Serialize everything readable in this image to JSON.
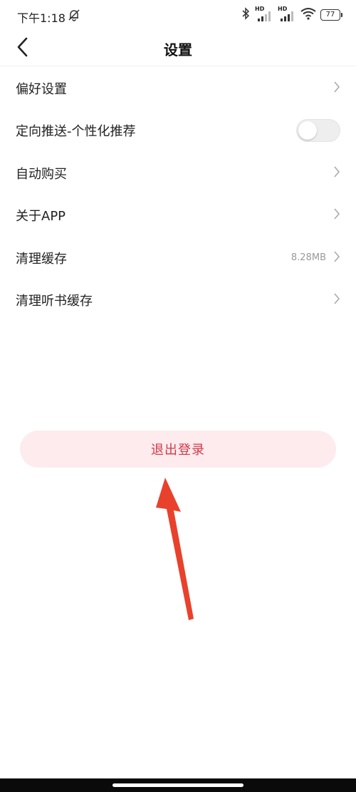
{
  "status_bar": {
    "time": "下午1:18",
    "hd_label_1": "HD",
    "hd_label_2": "HD",
    "battery": "77"
  },
  "header": {
    "title": "设置"
  },
  "menu": {
    "items": [
      {
        "label": "偏好设置",
        "trailing": "chevron"
      },
      {
        "label": "定向推送-个性化推荐",
        "trailing": "toggle",
        "toggle_on": false
      },
      {
        "label": "自动购买",
        "trailing": "chevron"
      },
      {
        "label": "关于APP",
        "trailing": "chevron"
      },
      {
        "label": "清理缓存",
        "trailing": "chevron",
        "value": "8.28MB"
      },
      {
        "label": "清理听书缓存",
        "trailing": "chevron"
      }
    ]
  },
  "logout": {
    "label": "退出登录"
  },
  "colors": {
    "logout_bg": "#fdebee",
    "logout_text": "#d23a46",
    "annotation_arrow": "#e8412c",
    "toggle_off_bg": "#eeeeee"
  },
  "icons": {
    "back": "chevron-left-icon",
    "menu_trailing": "chevron-right-icon",
    "status": [
      "bell-off-icon",
      "bluetooth-icon",
      "signal-icon",
      "wifi-icon",
      "battery-icon"
    ],
    "annotation": "red-arrow-pointing-up"
  }
}
